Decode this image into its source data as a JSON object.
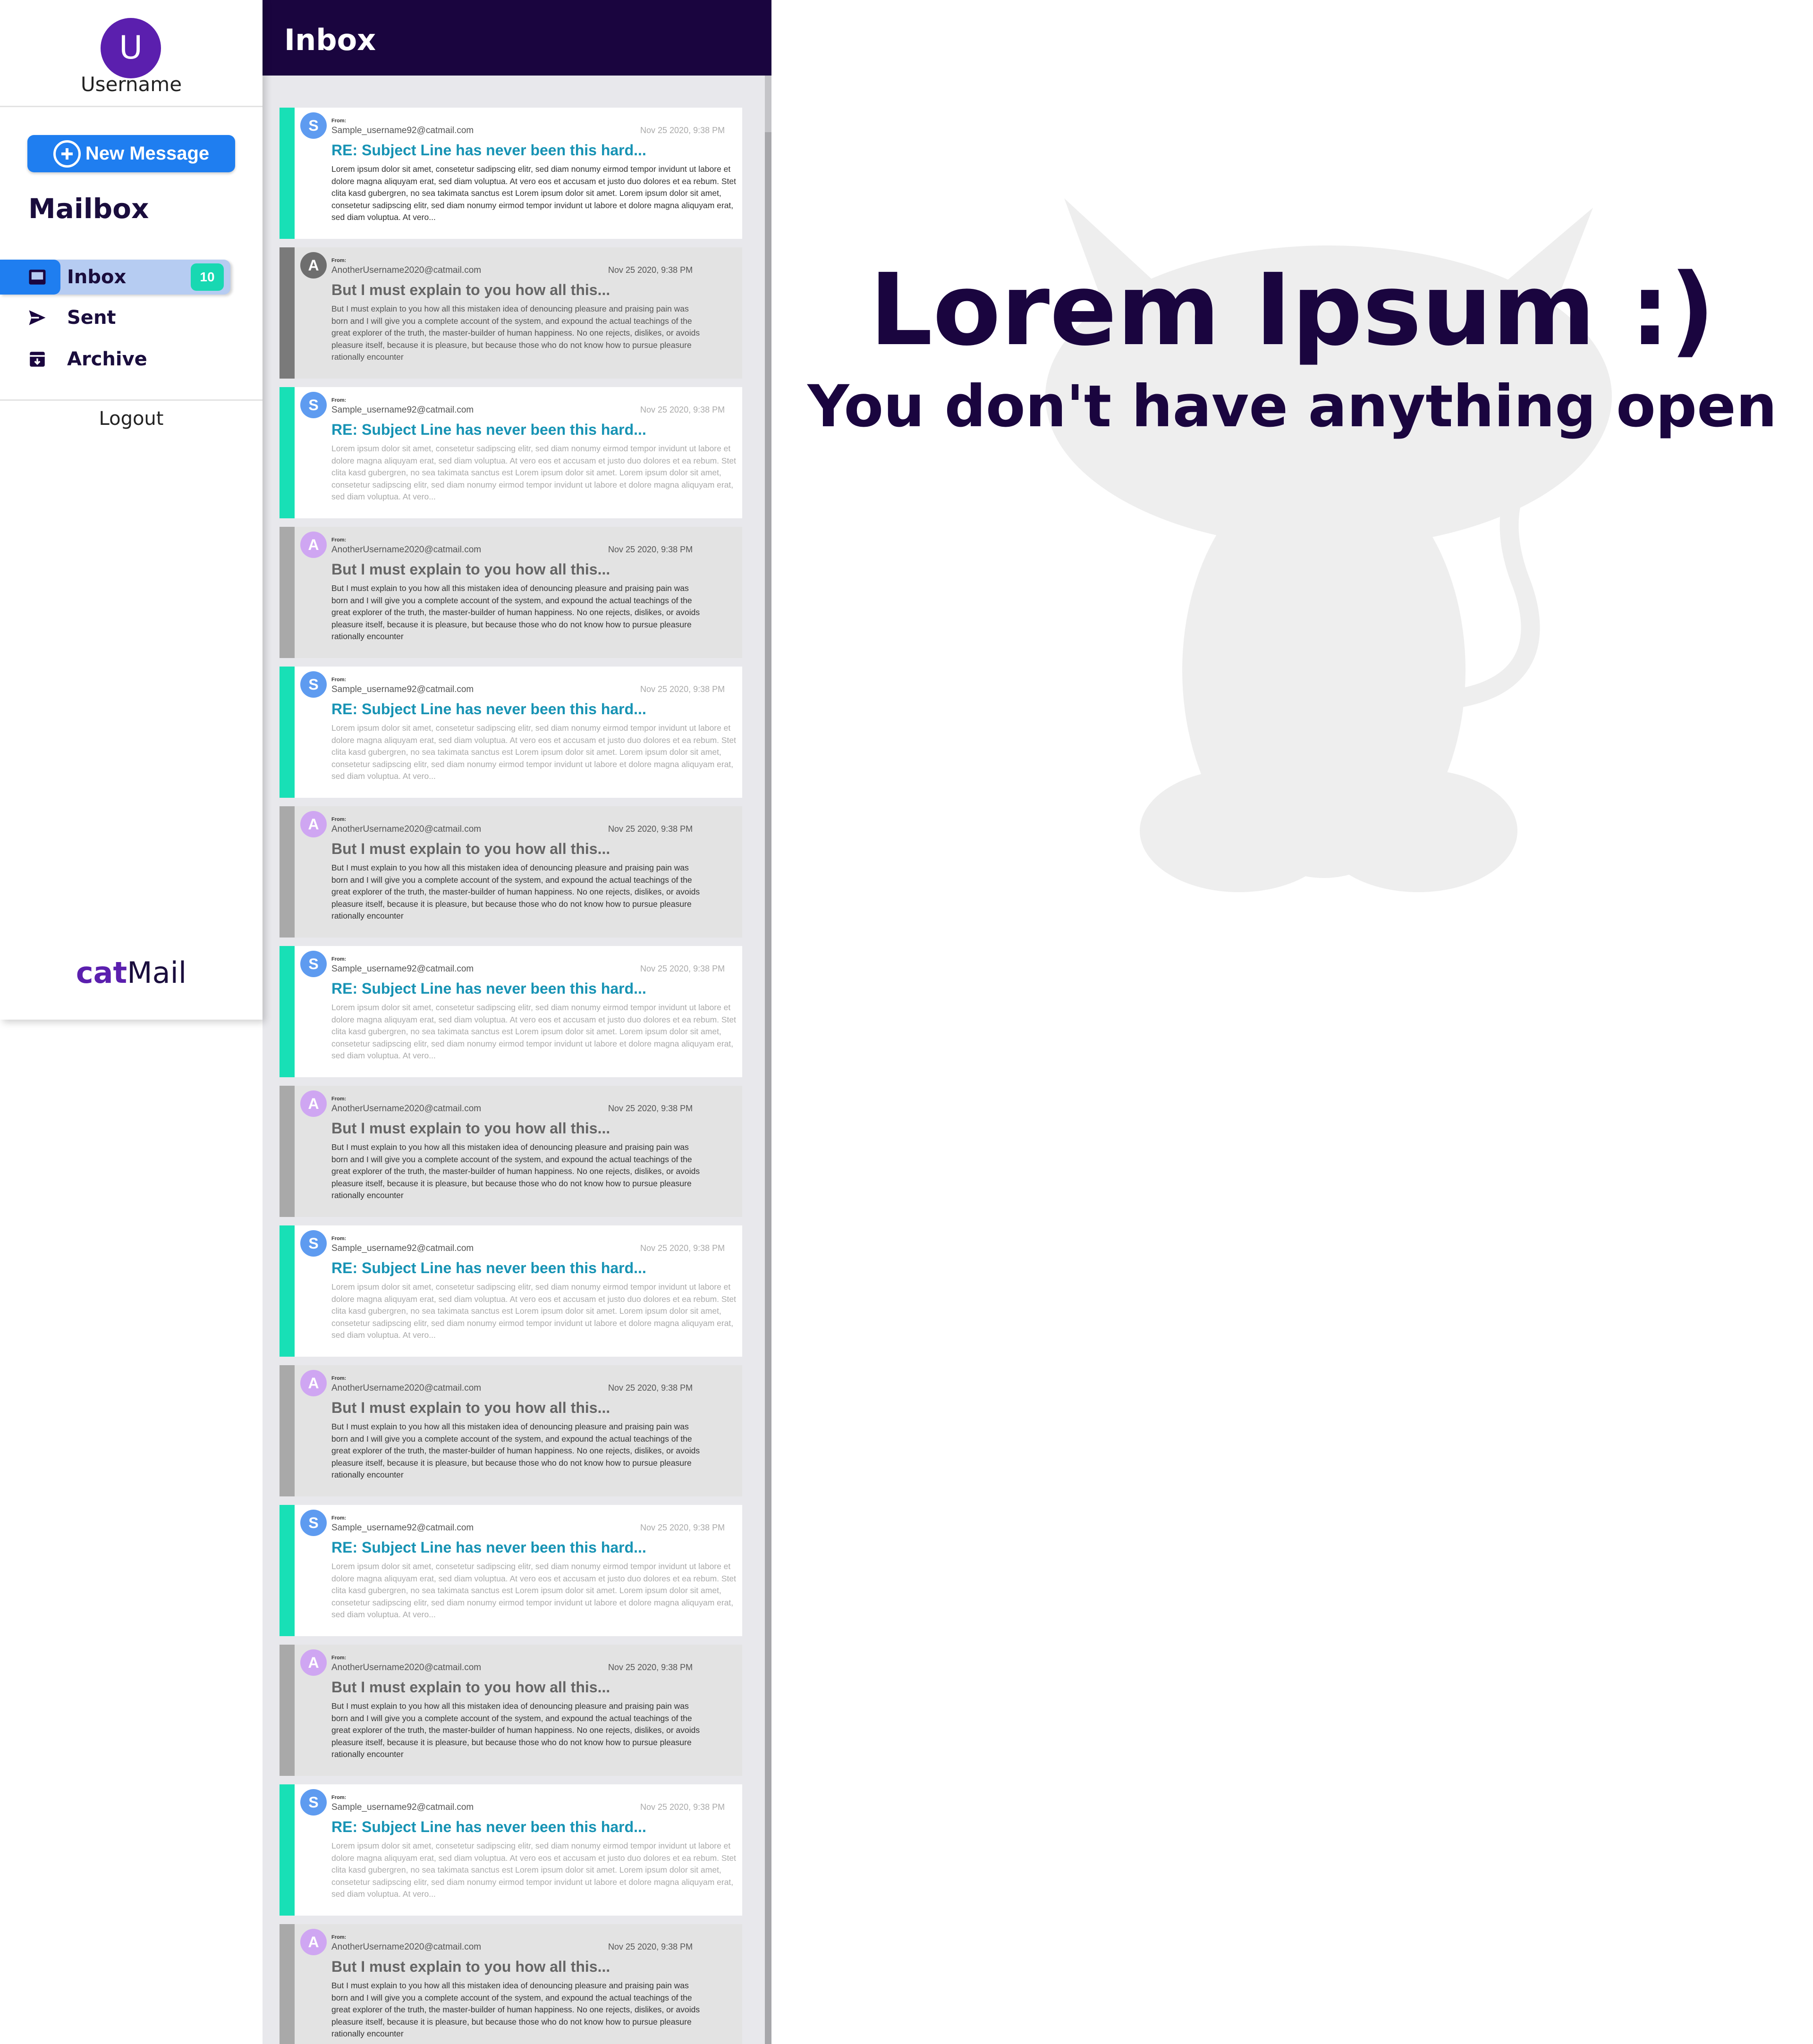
{
  "user": {
    "initial": "U",
    "name": "Username"
  },
  "compose": {
    "label": "New Message"
  },
  "mailbox": {
    "title": "Mailbox",
    "nav": [
      {
        "label": "Inbox",
        "icon": "inbox-icon",
        "badge": "10",
        "active": true
      },
      {
        "label": "Sent",
        "icon": "send-icon",
        "active": false
      },
      {
        "label": "Archive",
        "icon": "archive-icon",
        "active": false
      }
    ]
  },
  "logout": "Logout",
  "brand": {
    "bold": "cat",
    "rest": "Mail"
  },
  "inbox": {
    "title": "Inbox",
    "from_label": "From:",
    "messages": [
      {
        "type": "unread",
        "initial": "S",
        "from": "Sample_username92@catmail.com",
        "date": "Nov 25 2020, 9:38 PM",
        "subject": "RE: Subject Line has never been this hard...",
        "preview": "Lorem ipsum dolor sit amet, consetetur sadipscing elitr, sed diam nonumy eirmod tempor invidunt ut labore et dolore magna aliquyam erat, sed diam voluptua. At vero eos et accusam et justo duo dolores et ea rebum. Stet clita kasd gubergren, no sea takimata sanctus est Lorem ipsum dolor sit amet. Lorem ipsum dolor sit amet, consetetur sadipscing elitr, sed diam nonumy eirmod tempor invidunt ut labore et dolore magna aliquyam erat, sed diam voluptua. At vero..."
      },
      {
        "type": "read",
        "initial": "A",
        "from": "AnotherUsername2020@catmail.com",
        "date": "Nov 25 2020, 9:38 PM",
        "subject": "But I must explain to you how all this...",
        "preview": "But I must explain to you how all this mistaken idea of denouncing pleasure and praising pain was born and I will give you a complete account of the system, and expound the actual teachings of the great explorer of the truth, the master-builder of human happiness. No one rejects, dislikes, or avoids pleasure itself, because it is pleasure, but because those who do not know how to pursue pleasure rationally encounter"
      },
      {
        "type": "unread",
        "initial": "S",
        "from": "Sample_username92@catmail.com",
        "date": "Nov 25 2020, 9:38 PM",
        "subject": "RE: Subject Line has never been this hard...",
        "preview": "Lorem ipsum dolor sit amet, consetetur sadipscing elitr, sed diam nonumy eirmod tempor invidunt ut labore et dolore magna aliquyam erat, sed diam voluptua. At vero eos et accusam et justo duo dolores et ea rebum. Stet clita kasd gubergren, no sea takimata sanctus est Lorem ipsum dolor sit amet. Lorem ipsum dolor sit amet, consetetur sadipscing elitr, sed diam nonumy eirmod tempor invidunt ut labore et dolore magna aliquyam erat, sed diam voluptua. At vero..."
      },
      {
        "type": "read",
        "initial": "A",
        "from": "AnotherUsername2020@catmail.com",
        "date": "Nov 25 2020, 9:38 PM",
        "subject": "But I must explain to you how all this...",
        "preview": "But I must explain to you how all this mistaken idea of denouncing pleasure and praising pain was born and I will give you a complete account of the system, and expound the actual teachings of the great explorer of the truth, the master-builder of human happiness. No one rejects, dislikes, or avoids pleasure itself, because it is pleasure, but because those who do not know how to pursue pleasure rationally encounter"
      },
      {
        "type": "unread",
        "initial": "S",
        "from": "Sample_username92@catmail.com",
        "date": "Nov 25 2020, 9:38 PM",
        "subject": "RE: Subject Line has never been this hard...",
        "preview": "Lorem ipsum dolor sit amet, consetetur sadipscing elitr, sed diam nonumy eirmod tempor invidunt ut labore et dolore magna aliquyam erat, sed diam voluptua. At vero eos et accusam et justo duo dolores et ea rebum. Stet clita kasd gubergren, no sea takimata sanctus est Lorem ipsum dolor sit amet. Lorem ipsum dolor sit amet, consetetur sadipscing elitr, sed diam nonumy eirmod tempor invidunt ut labore et dolore magna aliquyam erat, sed diam voluptua. At vero..."
      },
      {
        "type": "read",
        "initial": "A",
        "from": "AnotherUsername2020@catmail.com",
        "date": "Nov 25 2020, 9:38 PM",
        "subject": "But I must explain to you how all this...",
        "preview": "But I must explain to you how all this mistaken idea of denouncing pleasure and praising pain was born and I will give you a complete account of the system, and expound the actual teachings of the great explorer of the truth, the master-builder of human happiness. No one rejects, dislikes, or avoids pleasure itself, because it is pleasure, but because those who do not know how to pursue pleasure rationally encounter"
      },
      {
        "type": "unread",
        "initial": "S",
        "from": "Sample_username92@catmail.com",
        "date": "Nov 25 2020, 9:38 PM",
        "subject": "RE: Subject Line has never been this hard...",
        "preview": "Lorem ipsum dolor sit amet, consetetur sadipscing elitr, sed diam nonumy eirmod tempor invidunt ut labore et dolore magna aliquyam erat, sed diam voluptua. At vero eos et accusam et justo duo dolores et ea rebum. Stet clita kasd gubergren, no sea takimata sanctus est Lorem ipsum dolor sit amet. Lorem ipsum dolor sit amet, consetetur sadipscing elitr, sed diam nonumy eirmod tempor invidunt ut labore et dolore magna aliquyam erat, sed diam voluptua. At vero..."
      },
      {
        "type": "read",
        "initial": "A",
        "from": "AnotherUsername2020@catmail.com",
        "date": "Nov 25 2020, 9:38 PM",
        "subject": "But I must explain to you how all this...",
        "preview": "But I must explain to you how all this mistaken idea of denouncing pleasure and praising pain was born and I will give you a complete account of the system, and expound the actual teachings of the great explorer of the truth, the master-builder of human happiness. No one rejects, dislikes, or avoids pleasure itself, because it is pleasure, but because those who do not know how to pursue pleasure rationally encounter"
      },
      {
        "type": "unread",
        "initial": "S",
        "from": "Sample_username92@catmail.com",
        "date": "Nov 25 2020, 9:38 PM",
        "subject": "RE: Subject Line has never been this hard...",
        "preview": "Lorem ipsum dolor sit amet, consetetur sadipscing elitr, sed diam nonumy eirmod tempor invidunt ut labore et dolore magna aliquyam erat, sed diam voluptua. At vero eos et accusam et justo duo dolores et ea rebum. Stet clita kasd gubergren, no sea takimata sanctus est Lorem ipsum dolor sit amet. Lorem ipsum dolor sit amet, consetetur sadipscing elitr, sed diam nonumy eirmod tempor invidunt ut labore et dolore magna aliquyam erat, sed diam voluptua. At vero..."
      },
      {
        "type": "read",
        "initial": "A",
        "from": "AnotherUsername2020@catmail.com",
        "date": "Nov 25 2020, 9:38 PM",
        "subject": "But I must explain to you how all this...",
        "preview": "But I must explain to you how all this mistaken idea of denouncing pleasure and praising pain was born and I will give you a complete account of the system, and expound the actual teachings of the great explorer of the truth, the master-builder of human happiness. No one rejects, dislikes, or avoids pleasure itself, because it is pleasure, but because those who do not know how to pursue pleasure rationally encounter"
      },
      {
        "type": "unread",
        "initial": "S",
        "from": "Sample_username92@catmail.com",
        "date": "Nov 25 2020, 9:38 PM",
        "subject": "RE: Subject Line has never been this hard...",
        "preview": "Lorem ipsum dolor sit amet, consetetur sadipscing elitr, sed diam nonumy eirmod tempor invidunt ut labore et dolore magna aliquyam erat, sed diam voluptua. At vero eos et accusam et justo duo dolores et ea rebum. Stet clita kasd gubergren, no sea takimata sanctus est Lorem ipsum dolor sit amet. Lorem ipsum dolor sit amet, consetetur sadipscing elitr, sed diam nonumy eirmod tempor invidunt ut labore et dolore magna aliquyam erat, sed diam voluptua. At vero..."
      },
      {
        "type": "read",
        "initial": "A",
        "from": "AnotherUsername2020@catmail.com",
        "date": "Nov 25 2020, 9:38 PM",
        "subject": "But I must explain to you how all this...",
        "preview": "But I must explain to you how all this mistaken idea of denouncing pleasure and praising pain was born and I will give you a complete account of the system, and expound the actual teachings of the great explorer of the truth, the master-builder of human happiness. No one rejects, dislikes, or avoids pleasure itself, because it is pleasure, but because those who do not know how to pursue pleasure rationally encounter"
      },
      {
        "type": "unread",
        "initial": "S",
        "from": "Sample_username92@catmail.com",
        "date": "Nov 25 2020, 9:38 PM",
        "subject": "RE: Subject Line has never been this hard...",
        "preview": "Lorem ipsum dolor sit amet, consetetur sadipscing elitr, sed diam nonumy eirmod tempor invidunt ut labore et dolore magna aliquyam erat, sed diam voluptua. At vero eos et accusam et justo duo dolores et ea rebum. Stet clita kasd gubergren, no sea takimata sanctus est Lorem ipsum dolor sit amet. Lorem ipsum dolor sit amet, consetetur sadipscing elitr, sed diam nonumy eirmod tempor invidunt ut labore et dolore magna aliquyam erat, sed diam voluptua. At vero..."
      },
      {
        "type": "read",
        "initial": "A",
        "from": "AnotherUsername2020@catmail.com",
        "date": "Nov 25 2020, 9:38 PM",
        "subject": "But I must explain to you how all this...",
        "preview": "But I must explain to you how all this mistaken idea of denouncing pleasure and praising pain was born and I will give you a complete account of the system, and expound the actual teachings of the great explorer of the truth, the master-builder of human happiness. No one rejects, dislikes, or avoids pleasure itself, because it is pleasure, but because those who do not know how to pursue pleasure rationally encounter"
      }
    ]
  },
  "empty_state": {
    "title": "Lorem Ipsum :)",
    "subtitle": "You don't have anything open",
    "illustration": "cat-silhouette"
  },
  "colors": {
    "header": "#1a053f",
    "primary": "#1f7ef0",
    "accent": "#18e0b6",
    "brand": "#5b1fae",
    "subject": "#1793b4"
  }
}
